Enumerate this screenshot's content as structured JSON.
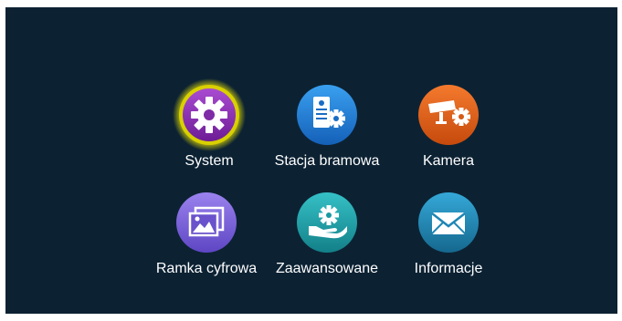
{
  "menu": {
    "items": [
      {
        "label": "System",
        "icon": "gear-icon",
        "color": "#8a2bb0",
        "selected": true
      },
      {
        "label": "Stacja bramowa",
        "icon": "door-station-icon",
        "color": "#1f7fd6"
      },
      {
        "label": "Kamera",
        "icon": "camera-icon",
        "color": "#e45d18"
      },
      {
        "label": "Ramka cyfrowa",
        "icon": "picture-frame-icon",
        "color": "#7a62d8"
      },
      {
        "label": "Zaawansowane",
        "icon": "hand-gear-icon",
        "color": "#1ea0a8"
      },
      {
        "label": "Informacje",
        "icon": "envelope-icon",
        "color": "#1f86b4"
      }
    ]
  },
  "colors": {
    "background": "#0c2233",
    "selection_ring": "#e8e000",
    "text": "#ffffff"
  }
}
